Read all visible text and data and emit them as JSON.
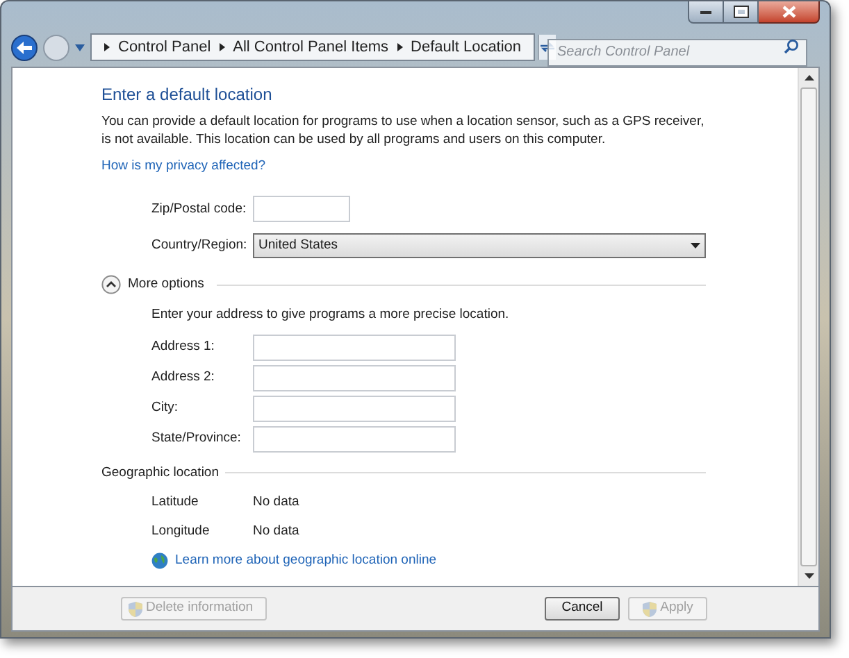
{
  "breadcrumbs": [
    "Control Panel",
    "All Control Panel Items",
    "Default Location"
  ],
  "search": {
    "placeholder": "Search Control Panel"
  },
  "heading": "Enter a default location",
  "description": "You can provide a default location for programs to use when a location sensor, such as a GPS receiver, is not available. This location can be used by all programs and users on this computer.",
  "privacy_link": "How is my privacy affected?",
  "zip": {
    "label": "Zip/Postal code:"
  },
  "country": {
    "label": "Country/Region:",
    "value": "United States"
  },
  "more_options": {
    "label": "More options",
    "expanded": true,
    "hint": "Enter your address to give programs a more precise location.",
    "fields": [
      {
        "label": "Address 1:"
      },
      {
        "label": "Address 2:"
      },
      {
        "label": "City:"
      },
      {
        "label": "State/Province:"
      }
    ]
  },
  "geographic": {
    "title": "Geographic location",
    "rows": [
      {
        "label": "Latitude",
        "value": "No data"
      },
      {
        "label": "Longitude",
        "value": "No data"
      }
    ],
    "link": "Learn more about geographic location online"
  },
  "buttons": [
    {
      "label": "Delete information",
      "kind": "shield",
      "disabled": true
    },
    {
      "label": "Cancel",
      "kind": "plain",
      "disabled": false
    },
    {
      "label": "Apply",
      "kind": "shield",
      "disabled": true
    }
  ]
}
